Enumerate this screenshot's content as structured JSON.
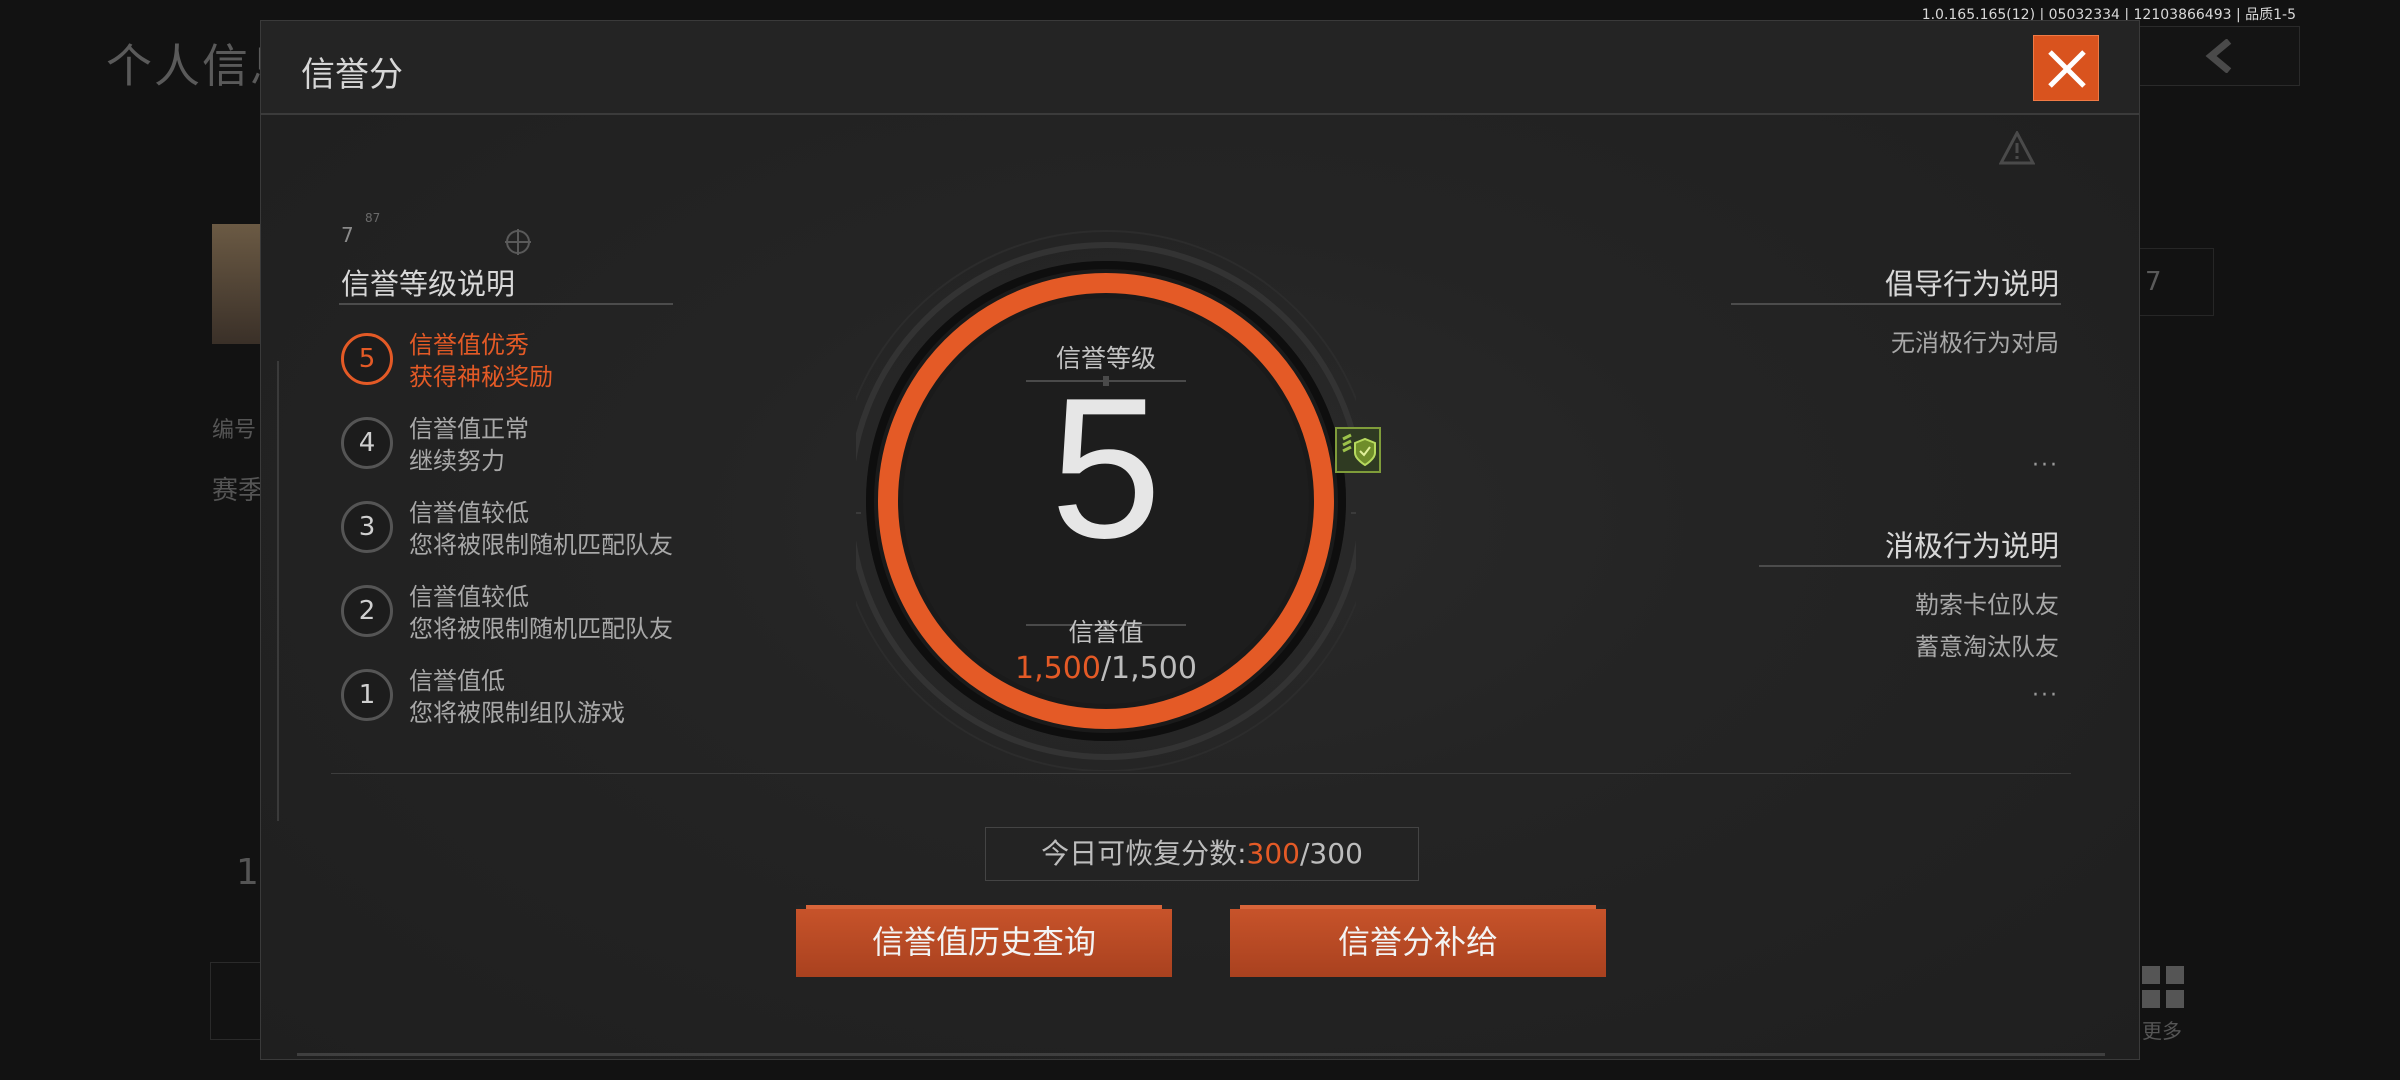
{
  "version": "1.0.165.165(12) | 05032334 | 12103866493 | 品质1-5",
  "background": {
    "title": "个人信息",
    "side_label_1": "编号",
    "side_label_2": "赛季",
    "number_1": "1",
    "select_value": "7",
    "more_label": "更多"
  },
  "modal": {
    "title": "信誉分",
    "close_icon": "close-icon",
    "left": {
      "deco_num": "7",
      "deco_sup": "87",
      "title": "信誉等级说明",
      "levels": [
        {
          "num": "5",
          "line1": "信誉值优秀",
          "line2": "获得神秘奖励",
          "active": true
        },
        {
          "num": "4",
          "line1": "信誉值正常",
          "line2": "继续努力"
        },
        {
          "num": "3",
          "line1": "信誉值较低",
          "line2": "您将被限制随机匹配队友"
        },
        {
          "num": "2",
          "line1": "信誉值较低",
          "line2": "您将被限制随机匹配队友"
        },
        {
          "num": "1",
          "line1": "信誉值低",
          "line2": "您将被限制组队游戏"
        }
      ]
    },
    "center": {
      "level_title": "信誉等级",
      "level": "5",
      "value_title": "信誉值",
      "value_current": "1,500",
      "value_max": "/1,500",
      "accent_color": "#e45a26"
    },
    "right": {
      "advocate_title": "倡导行为说明",
      "advocate_items": [
        "无消极行为对局"
      ],
      "advocate_more": "···",
      "negative_title": "消极行为说明",
      "negative_items": [
        "勒索卡位队友",
        "蓄意淘汰队友"
      ],
      "negative_more": "···"
    },
    "bottom": {
      "recover_label": "今日可恢复分数:",
      "recover_current": "300",
      "recover_max": "/300",
      "history_button": "信誉值历史查询",
      "supply_button": "信誉分补给"
    }
  }
}
